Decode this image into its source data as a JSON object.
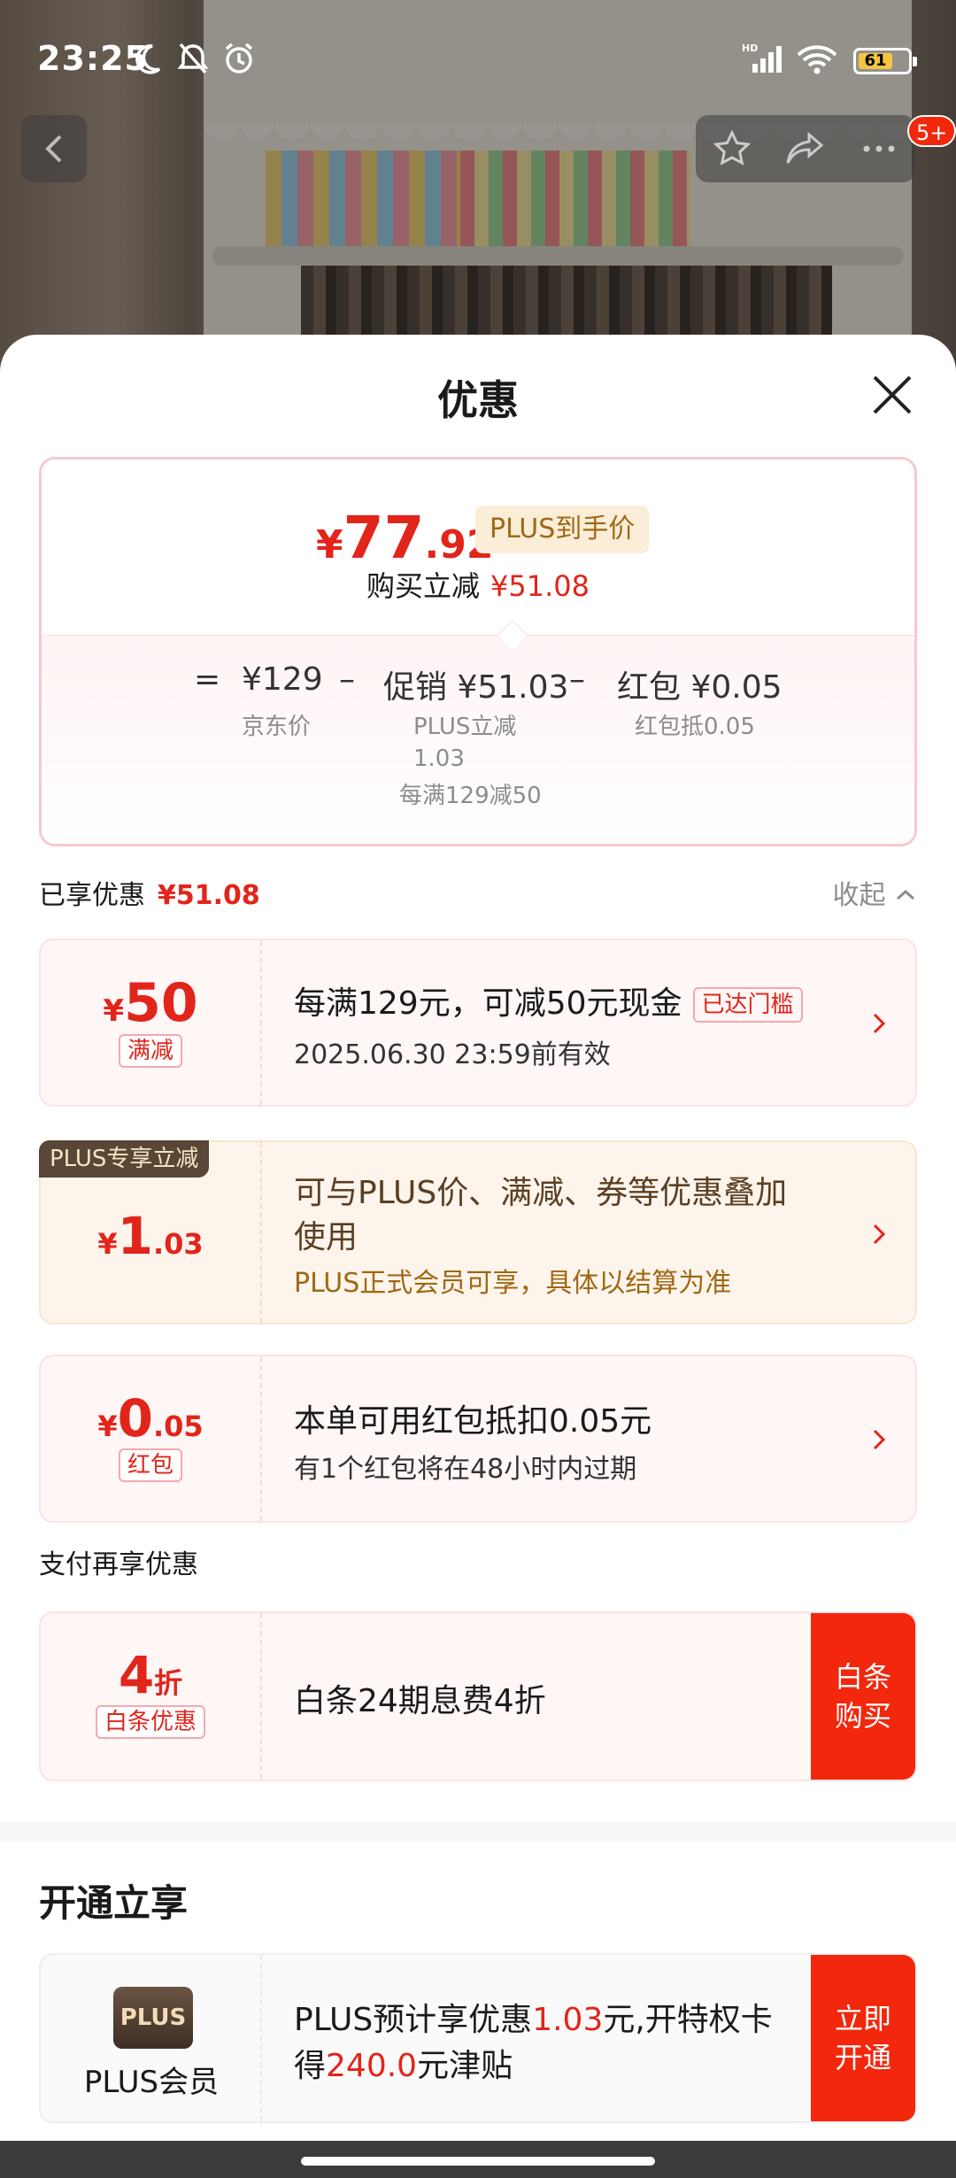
{
  "status_bar": {
    "time": "23:25",
    "battery": "61"
  },
  "nav": {
    "badge": "5+"
  },
  "sheet": {
    "title": "优惠",
    "summary": {
      "final_yen": "¥",
      "final_int": "77",
      "final_dec": ".92",
      "plus_tag": "PLUS到手价",
      "reduce_label": "购买立减",
      "reduce_amount": "¥51.08",
      "eq": "=",
      "jd_price": "¥129",
      "jd_label": "京东价",
      "minus1": "–",
      "promo": "促销 ¥51.03",
      "promo_sub1": "PLUS立减",
      "promo_sub2": "1.03",
      "promo_sub3": "每满129减50",
      "minus2": "–",
      "redpacket": "红包 ¥0.05",
      "redpacket_sub": "红包抵0.05"
    },
    "enjoyed": {
      "label": "已享优惠",
      "amount": "¥51.08",
      "collapse": "收起"
    },
    "cards": [
      {
        "yen": "¥",
        "amount": "50",
        "tag": "满减",
        "main": "每满129元，可减50元现金",
        "threshold": "已达门槛",
        "sub": "2025.06.30 23:59前有效"
      },
      {
        "corner": "PLUS专享立减",
        "yen": "¥",
        "amount": "1",
        "dec": ".03",
        "main1": "可与PLUS价、满减、券等优惠叠加",
        "main2": "使用",
        "sub": "PLUS正式会员可享，具体以结算为准"
      },
      {
        "yen": "¥",
        "amount": "0",
        "dec": ".05",
        "tag": "红包",
        "main": "本单可用红包抵扣0.05元",
        "sub": "有1个红包将在48小时内过期"
      }
    ],
    "pay_section": {
      "label": "支付再享优惠",
      "amount": "4",
      "unit": "折",
      "tag": "白条优惠",
      "main": "白条24期息费4折",
      "cta1": "白条",
      "cta2": "购买"
    },
    "open_section": {
      "title": "开通立享",
      "logo": "PLUS",
      "name": "PLUS会员",
      "line1_a": "PLUS预计享优惠",
      "line1_b": "1.03",
      "line1_c": "元,开特权卡",
      "line2_a": "得",
      "line2_b": "240.0",
      "line2_c": "元津贴",
      "cta1": "立即",
      "cta2": "开通"
    }
  },
  "colors": {
    "accent": "#e1251b",
    "cta": "#f2270c",
    "plus_gold": "#a06814"
  }
}
